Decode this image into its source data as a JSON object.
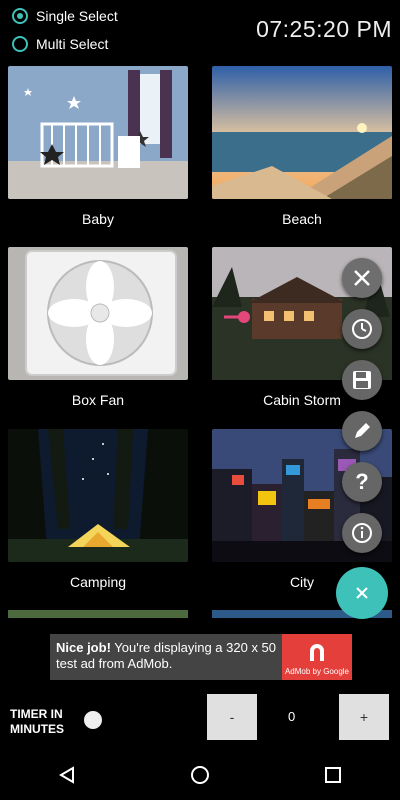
{
  "top": {
    "radio_single": "Single Select",
    "radio_multi": "Multi Select",
    "clock": "07:25:20 PM"
  },
  "tiles": [
    {
      "label": "Baby"
    },
    {
      "label": "Beach"
    },
    {
      "label": "Box Fan"
    },
    {
      "label": "Cabin Storm"
    },
    {
      "label": "Camping"
    },
    {
      "label": "City"
    }
  ],
  "ad": {
    "bold": "Nice job!",
    "text": " You're displaying a 320 x 50 test ad from AdMob.",
    "brand": "AdMob by Google"
  },
  "timer": {
    "label_line1": "TIMER IN",
    "label_line2": "MINUTES",
    "minus": "-",
    "plus": "+",
    "value": "0"
  },
  "colors": {
    "accent": "#3EC1B8",
    "ad_red": "#E43F3A"
  },
  "icons": {
    "fab_close": "close-icon",
    "fab_timer": "clock-icon",
    "fab_save": "save-icon",
    "fab_edit": "pencil-icon",
    "fab_help": "help-icon",
    "fab_info": "info-icon",
    "fab_main": "close-icon"
  }
}
